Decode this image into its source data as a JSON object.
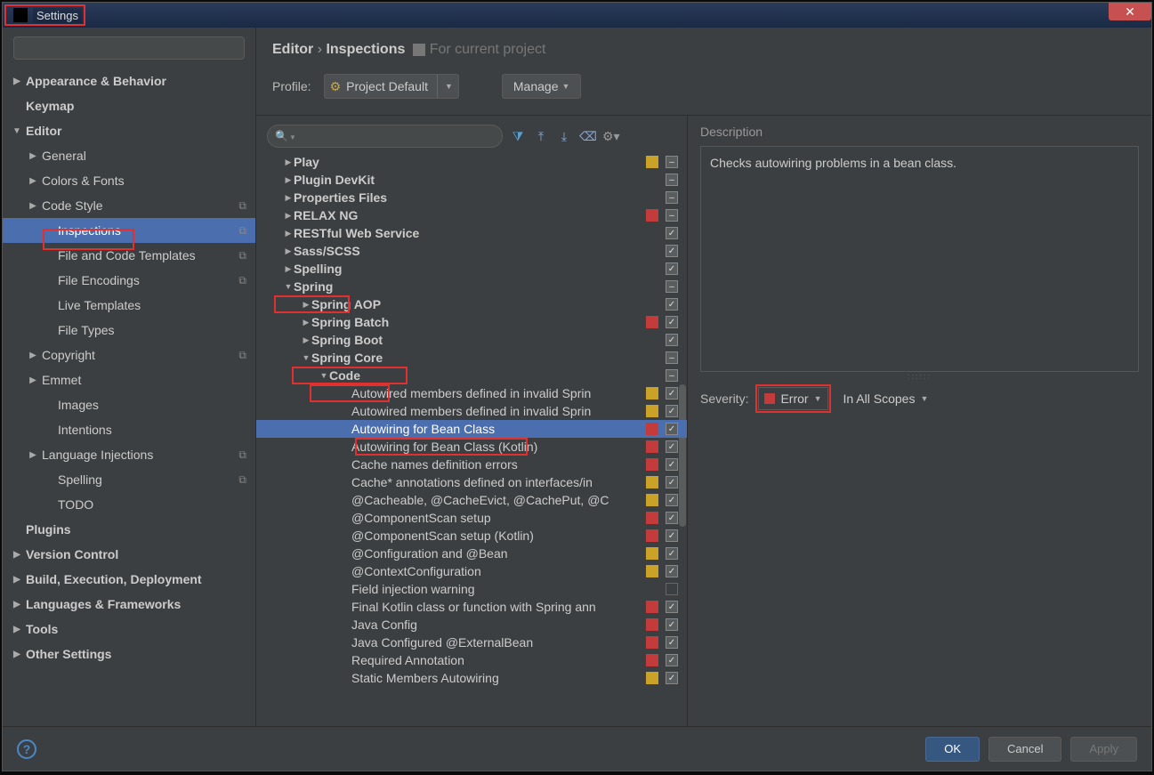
{
  "window": {
    "title": "Settings",
    "close": "✕"
  },
  "breadcrumb": {
    "a": "Editor",
    "sep": "›",
    "b": "Inspections",
    "hint": "For current project"
  },
  "profile": {
    "label": "Profile:",
    "value": "Project Default",
    "manage": "Manage"
  },
  "nav": [
    {
      "l": "Appearance & Behavior",
      "a": "▶",
      "b": true,
      "i": 0
    },
    {
      "l": "Keymap",
      "a": "",
      "b": true,
      "i": 0
    },
    {
      "l": "Editor",
      "a": "▼",
      "b": true,
      "i": 0
    },
    {
      "l": "General",
      "a": "▶",
      "b": false,
      "i": 1
    },
    {
      "l": "Colors & Fonts",
      "a": "▶",
      "b": false,
      "i": 1
    },
    {
      "l": "Code Style",
      "a": "▶",
      "b": false,
      "i": 1,
      "c": true
    },
    {
      "l": "Inspections",
      "a": "",
      "b": false,
      "i": 2,
      "sel": true,
      "c": true
    },
    {
      "l": "File and Code Templates",
      "a": "",
      "b": false,
      "i": 2,
      "c": true
    },
    {
      "l": "File Encodings",
      "a": "",
      "b": false,
      "i": 2,
      "c": true
    },
    {
      "l": "Live Templates",
      "a": "",
      "b": false,
      "i": 2
    },
    {
      "l": "File Types",
      "a": "",
      "b": false,
      "i": 2
    },
    {
      "l": "Copyright",
      "a": "▶",
      "b": false,
      "i": 1,
      "c": true
    },
    {
      "l": "Emmet",
      "a": "▶",
      "b": false,
      "i": 1
    },
    {
      "l": "Images",
      "a": "",
      "b": false,
      "i": 2
    },
    {
      "l": "Intentions",
      "a": "",
      "b": false,
      "i": 2
    },
    {
      "l": "Language Injections",
      "a": "▶",
      "b": false,
      "i": 1,
      "c": true
    },
    {
      "l": "Spelling",
      "a": "",
      "b": false,
      "i": 2,
      "c": true
    },
    {
      "l": "TODO",
      "a": "",
      "b": false,
      "i": 2
    },
    {
      "l": "Plugins",
      "a": "",
      "b": true,
      "i": 0
    },
    {
      "l": "Version Control",
      "a": "▶",
      "b": true,
      "i": 0
    },
    {
      "l": "Build, Execution, Deployment",
      "a": "▶",
      "b": true,
      "i": 0
    },
    {
      "l": "Languages & Frameworks",
      "a": "▶",
      "b": true,
      "i": 0
    },
    {
      "l": "Tools",
      "a": "▶",
      "b": true,
      "i": 0
    },
    {
      "l": "Other Settings",
      "a": "▶",
      "b": true,
      "i": 0
    }
  ],
  "tree": [
    {
      "l": "Play",
      "a": "▶",
      "p": 1,
      "b": true,
      "s": "yellow",
      "c": "dash"
    },
    {
      "l": "Plugin DevKit",
      "a": "▶",
      "p": 1,
      "b": true,
      "s": "none",
      "c": "dash"
    },
    {
      "l": "Properties Files",
      "a": "▶",
      "p": 1,
      "b": true,
      "s": "none",
      "c": "dash"
    },
    {
      "l": "RELAX NG",
      "a": "▶",
      "p": 1,
      "b": true,
      "s": "red",
      "c": "dash"
    },
    {
      "l": "RESTful Web Service",
      "a": "▶",
      "p": 1,
      "b": true,
      "s": "none",
      "c": "check"
    },
    {
      "l": "Sass/SCSS",
      "a": "▶",
      "p": 1,
      "b": true,
      "s": "none",
      "c": "check"
    },
    {
      "l": "Spelling",
      "a": "▶",
      "p": 1,
      "b": true,
      "s": "none",
      "c": "check"
    },
    {
      "l": "Spring",
      "a": "▼",
      "p": 1,
      "b": true,
      "s": "none",
      "c": "dash"
    },
    {
      "l": "Spring AOP",
      "a": "▶",
      "p": 2,
      "b": true,
      "s": "none",
      "c": "check"
    },
    {
      "l": "Spring Batch",
      "a": "▶",
      "p": 2,
      "b": true,
      "s": "red",
      "c": "check"
    },
    {
      "l": "Spring Boot",
      "a": "▶",
      "p": 2,
      "b": true,
      "s": "none",
      "c": "check"
    },
    {
      "l": "Spring Core",
      "a": "▼",
      "p": 2,
      "b": true,
      "s": "none",
      "c": "dash"
    },
    {
      "l": "Code",
      "a": "▼",
      "p": 3,
      "b": true,
      "s": "none",
      "c": "dash"
    },
    {
      "l": "Autowired members defined in invalid Sprin",
      "a": "",
      "p": 4,
      "b": false,
      "s": "yellow",
      "c": "check"
    },
    {
      "l": "Autowired members defined in invalid Sprin",
      "a": "",
      "p": 4,
      "b": false,
      "s": "yellow",
      "c": "check"
    },
    {
      "l": "Autowiring for Bean Class",
      "a": "",
      "p": 4,
      "b": false,
      "s": "red",
      "c": "check",
      "sel": true
    },
    {
      "l": "Autowiring for Bean Class (Kotlin)",
      "a": "",
      "p": 4,
      "b": false,
      "s": "red",
      "c": "check"
    },
    {
      "l": "Cache names definition errors",
      "a": "",
      "p": 4,
      "b": false,
      "s": "red",
      "c": "check"
    },
    {
      "l": "Cache* annotations defined on interfaces/in",
      "a": "",
      "p": 4,
      "b": false,
      "s": "yellow",
      "c": "check"
    },
    {
      "l": "@Cacheable, @CacheEvict, @CachePut, @C",
      "a": "",
      "p": 4,
      "b": false,
      "s": "yellow",
      "c": "check"
    },
    {
      "l": "@ComponentScan setup",
      "a": "",
      "p": 4,
      "b": false,
      "s": "red",
      "c": "check"
    },
    {
      "l": "@ComponentScan setup (Kotlin)",
      "a": "",
      "p": 4,
      "b": false,
      "s": "red",
      "c": "check"
    },
    {
      "l": "@Configuration and @Bean",
      "a": "",
      "p": 4,
      "b": false,
      "s": "yellow",
      "c": "check"
    },
    {
      "l": "@ContextConfiguration",
      "a": "",
      "p": 4,
      "b": false,
      "s": "yellow",
      "c": "check"
    },
    {
      "l": "Field injection warning",
      "a": "",
      "p": 4,
      "b": false,
      "s": "none",
      "c": ""
    },
    {
      "l": "Final Kotlin class or function with Spring ann",
      "a": "",
      "p": 4,
      "b": false,
      "s": "red",
      "c": "check"
    },
    {
      "l": "Java Config",
      "a": "",
      "p": 4,
      "b": false,
      "s": "red",
      "c": "check"
    },
    {
      "l": "Java Configured @ExternalBean",
      "a": "",
      "p": 4,
      "b": false,
      "s": "red",
      "c": "check"
    },
    {
      "l": "Required Annotation",
      "a": "",
      "p": 4,
      "b": false,
      "s": "red",
      "c": "check"
    },
    {
      "l": "Static Members Autowiring",
      "a": "",
      "p": 4,
      "b": false,
      "s": "yellow",
      "c": "check"
    }
  ],
  "desc": {
    "label": "Description",
    "text": "Checks autowiring problems in a bean class."
  },
  "severity": {
    "label": "Severity:",
    "value": "Error",
    "scope": "In All Scopes"
  },
  "footer": {
    "ok": "OK",
    "cancel": "Cancel",
    "apply": "Apply"
  }
}
